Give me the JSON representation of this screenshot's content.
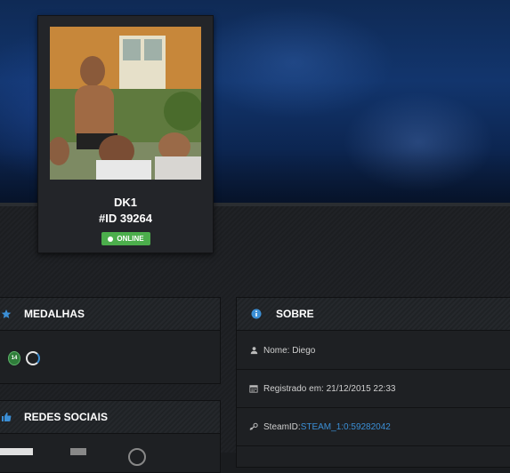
{
  "profile": {
    "username": "DK1",
    "id_label": "#ID 39264",
    "status": "ONLINE",
    "status_color": "#4cae4c"
  },
  "medals": {
    "title": "MEDALHAS",
    "items": [
      {
        "badge": "14",
        "icon": "green-medal-icon"
      },
      {
        "icon": "ring-medal-icon"
      }
    ]
  },
  "social": {
    "title": "REDES SOCIAIS"
  },
  "about": {
    "title": "SOBRE",
    "rows": [
      {
        "icon": "user-icon",
        "text": "Nome: Diego"
      },
      {
        "icon": "calendar-icon",
        "text": "Registrado em: 21/12/2015 22:33"
      },
      {
        "icon": "steam-icon",
        "label": "SteamID: ",
        "value": "STEAM_1:0:59282042"
      }
    ]
  },
  "colors": {
    "accent": "#3b8fd6",
    "background": "#1a1c1f",
    "online": "#4cae4c"
  }
}
